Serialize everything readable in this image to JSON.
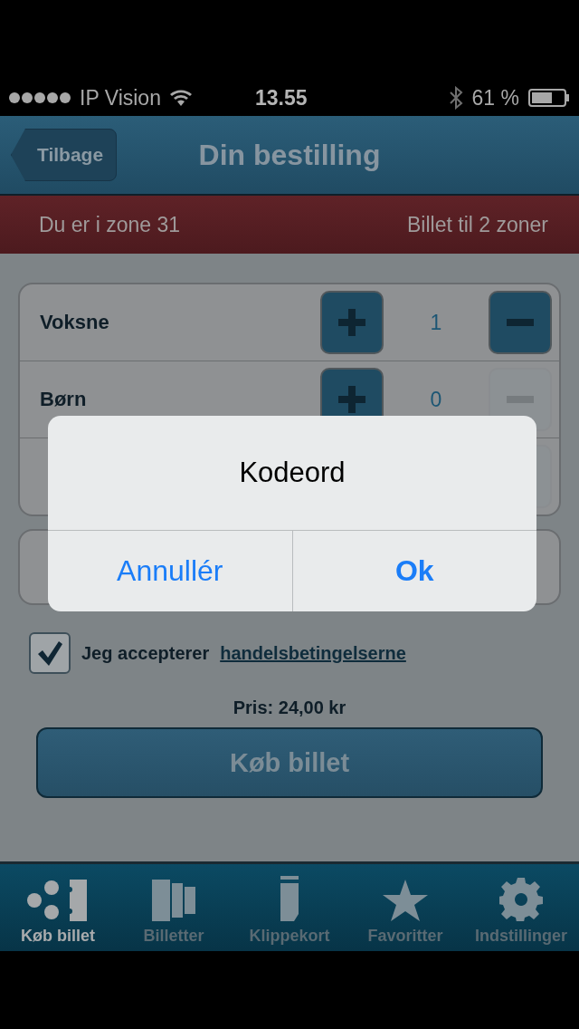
{
  "status_bar": {
    "carrier": "IP Vision",
    "time": "13.55",
    "battery": "61 %"
  },
  "nav_bar": {
    "back": "Tilbage",
    "title": "Din bestilling"
  },
  "zone_bar": {
    "left": "Du er i zone 31",
    "right": "Billet til 2 zoner"
  },
  "passengers": [
    {
      "label": "Voksne",
      "count": "1",
      "minus_disabled": false
    },
    {
      "label": "Børn",
      "count": "0",
      "minus_disabled": true
    },
    {
      "minus_disabled": true
    }
  ],
  "terms": {
    "checked": true,
    "text": "Jeg accepterer",
    "link": "handelsbetingelserne"
  },
  "price": "Pris: 24,00 kr",
  "buy_button": "Køb billet",
  "tabs": [
    {
      "label": "Køb billet",
      "selected": true
    },
    {
      "label": "Billetter",
      "selected": false
    },
    {
      "label": "Klippekort",
      "selected": false
    },
    {
      "label": "Favoritter",
      "selected": false
    },
    {
      "label": "Indstillinger",
      "selected": false
    }
  ],
  "dialog": {
    "title": "Kodeord",
    "buttons": [
      "Annullér",
      "Ok"
    ]
  }
}
